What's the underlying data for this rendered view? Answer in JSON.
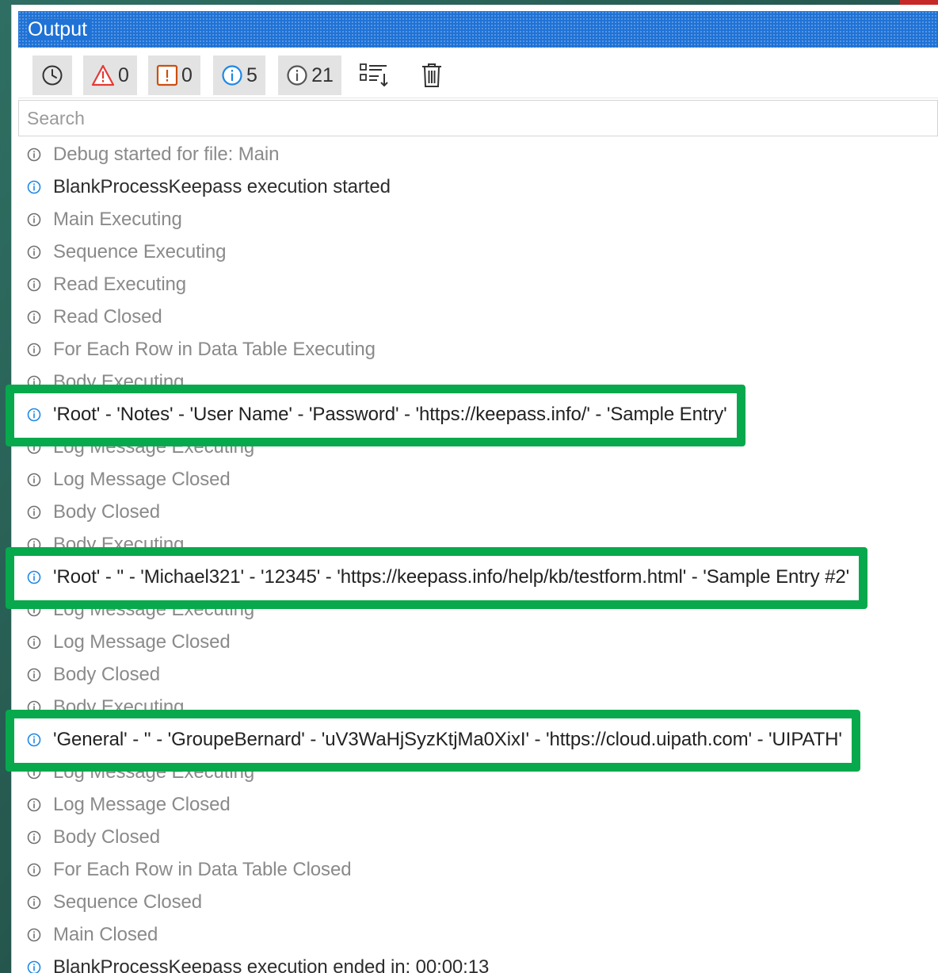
{
  "panel": {
    "title": "Output"
  },
  "toolbar": {
    "errors_count": "0",
    "warnings_count": "0",
    "info_count": "5",
    "trace_count": "21"
  },
  "search": {
    "placeholder": "Search"
  },
  "colors": {
    "title_bar": "#1f72d6",
    "highlight": "#07a94c",
    "error_icon": "#e53935",
    "warning_icon": "#ca5010",
    "info_icon": "#1e88e5",
    "trace_icon": "#707070"
  },
  "log": {
    "entries": [
      {
        "level": "trace",
        "text": "Debug started for file: Main"
      },
      {
        "level": "info",
        "text": "BlankProcessKeepass execution started"
      },
      {
        "level": "trace",
        "text": "Main Executing"
      },
      {
        "level": "trace",
        "text": "Sequence Executing"
      },
      {
        "level": "trace",
        "text": "Read Executing"
      },
      {
        "level": "trace",
        "text": "Read Closed"
      },
      {
        "level": "trace",
        "text": "For Each Row in Data Table Executing"
      },
      {
        "level": "trace",
        "text": "Body Executing"
      },
      {
        "level": "info",
        "highlighted": true,
        "text": "'Root' - 'Notes' - 'User Name' - 'Password' - 'https://keepass.info/' - 'Sample Entry'"
      },
      {
        "level": "trace",
        "text": "Log Message Executing"
      },
      {
        "level": "trace",
        "text": "Log Message Closed"
      },
      {
        "level": "trace",
        "text": "Body Closed"
      },
      {
        "level": "trace",
        "text": "Body Executing"
      },
      {
        "level": "info",
        "highlighted": true,
        "text": "'Root' - '' - 'Michael321' - '12345' - 'https://keepass.info/help/kb/testform.html' - 'Sample Entry #2'"
      },
      {
        "level": "trace",
        "text": "Log Message Executing"
      },
      {
        "level": "trace",
        "text": "Log Message Closed"
      },
      {
        "level": "trace",
        "text": "Body Closed"
      },
      {
        "level": "trace",
        "text": "Body Executing"
      },
      {
        "level": "info",
        "highlighted": true,
        "text": "'General' - '' - 'GroupeBernard' - 'uV3WaHjSyzKtjMa0XixI' - 'https://cloud.uipath.com' - 'UIPATH'"
      },
      {
        "level": "trace",
        "text": "Log Message Executing"
      },
      {
        "level": "trace",
        "text": "Log Message Closed"
      },
      {
        "level": "trace",
        "text": "Body Closed"
      },
      {
        "level": "trace",
        "text": "For Each Row in Data Table Closed"
      },
      {
        "level": "trace",
        "text": "Sequence Closed"
      },
      {
        "level": "trace",
        "text": "Main Closed"
      },
      {
        "level": "info",
        "text": "BlankProcessKeepass execution ended in: 00:00:13"
      }
    ]
  }
}
